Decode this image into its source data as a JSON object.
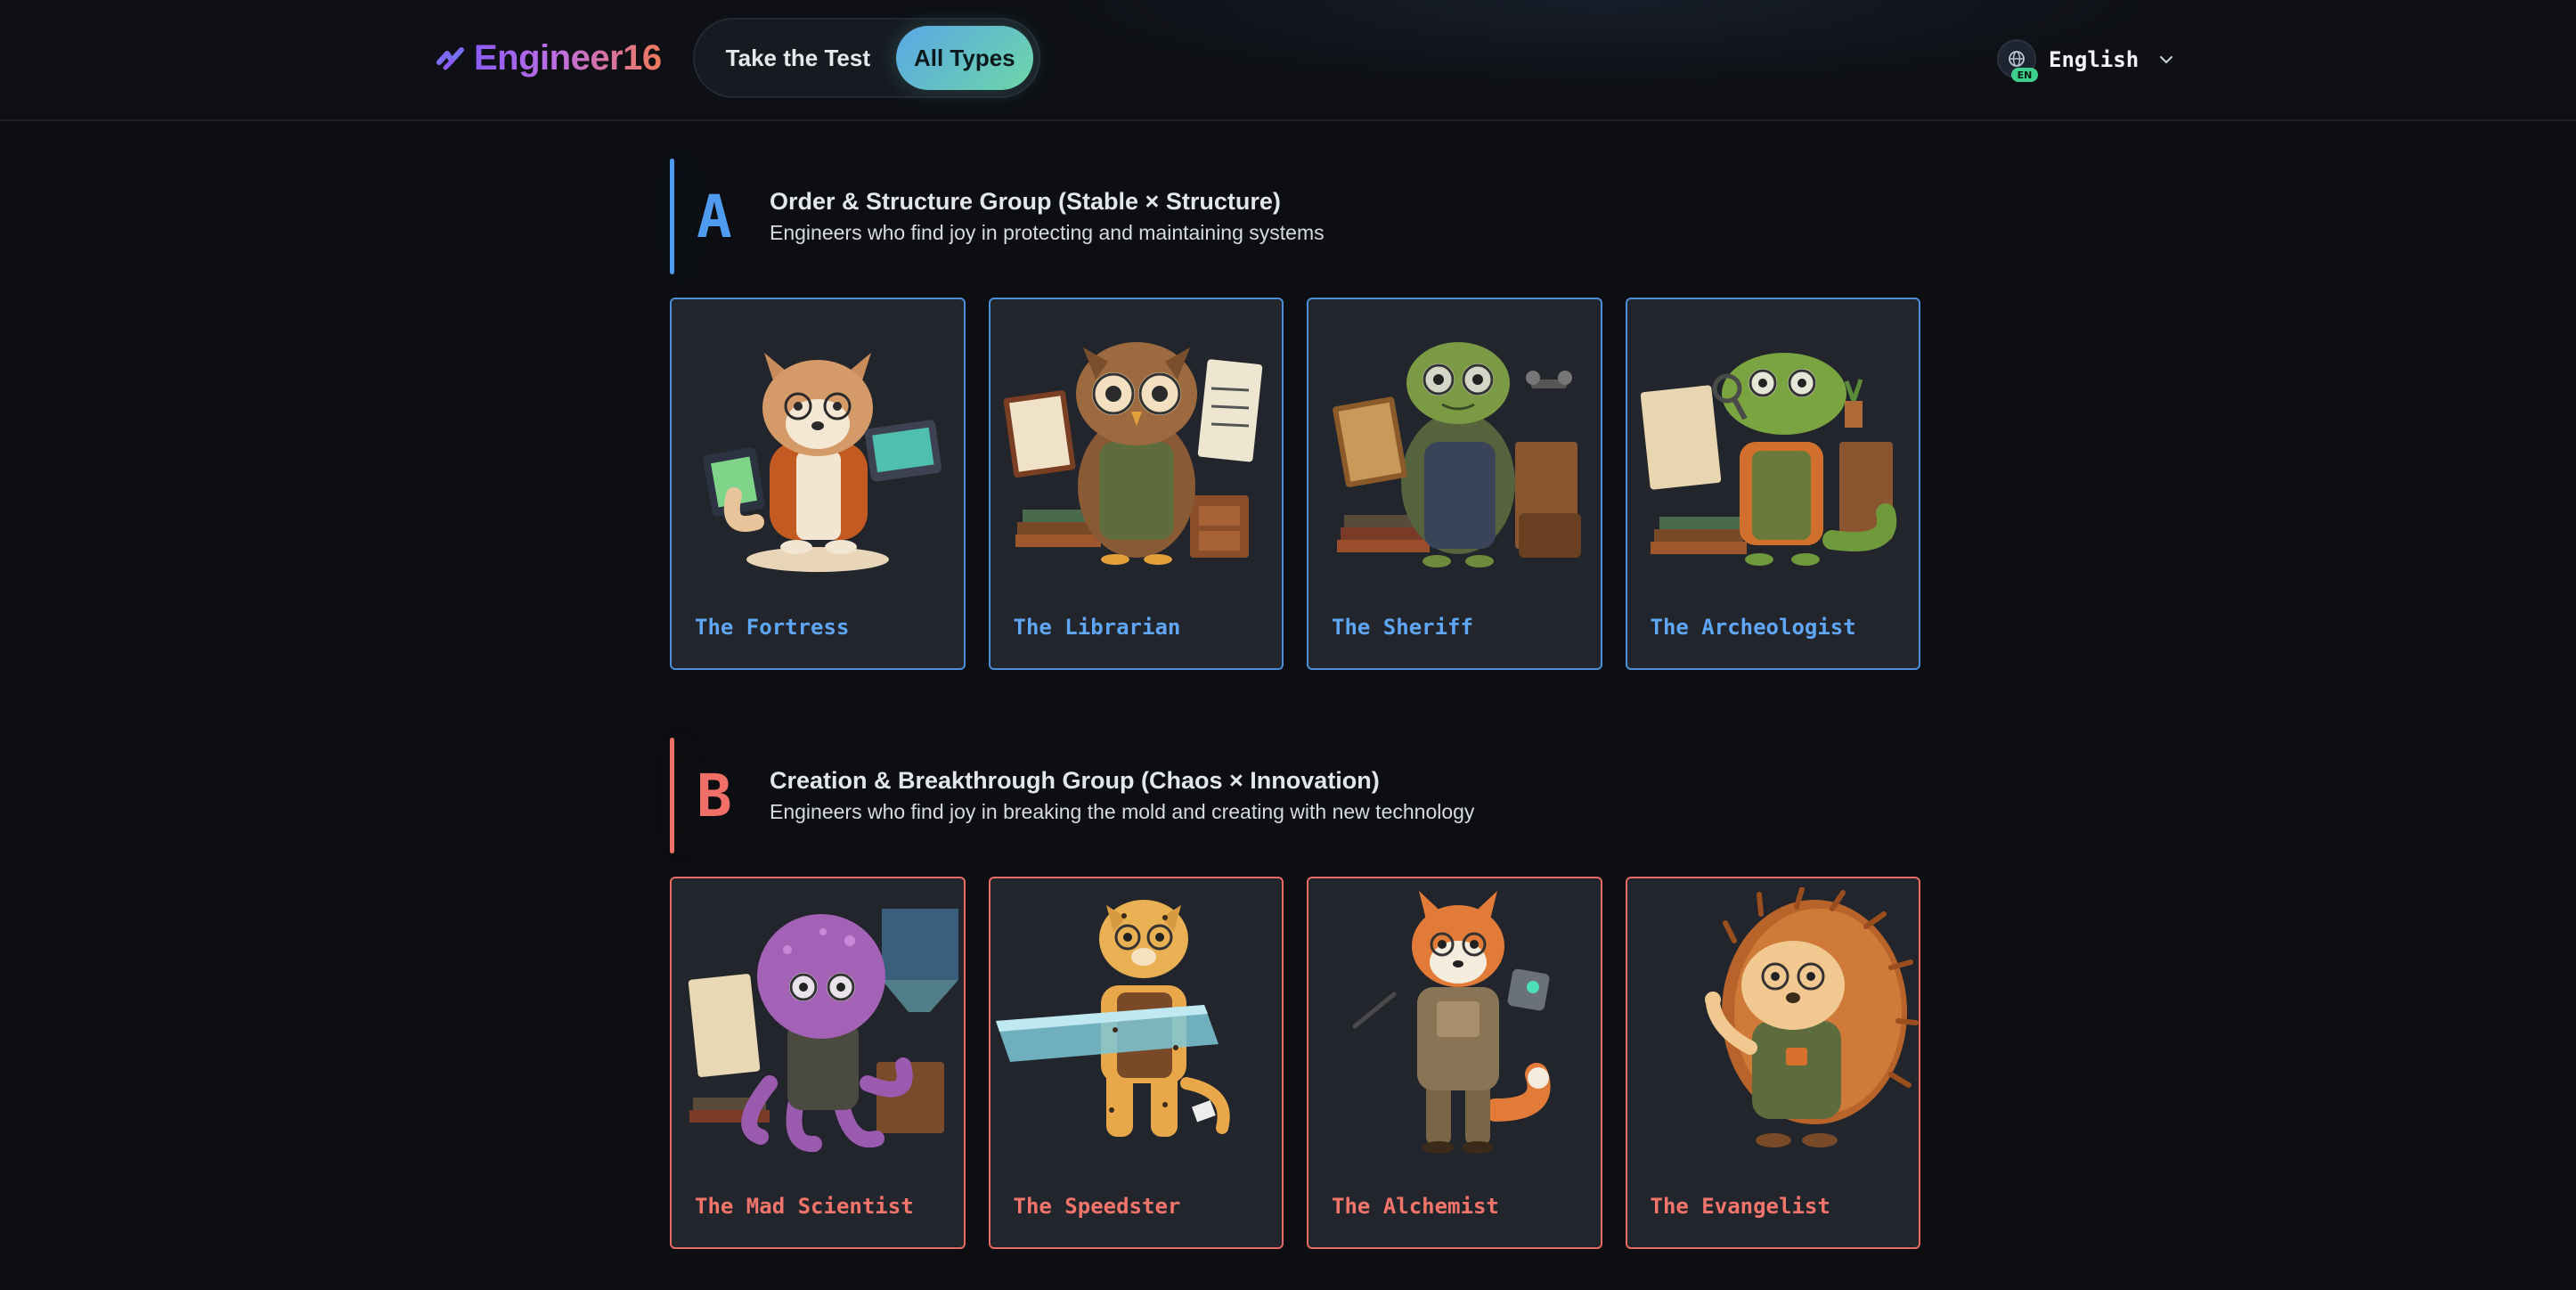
{
  "header": {
    "logo_text": "Engineer16",
    "nav": {
      "take_test": "Take the Test",
      "all_types": "All Types"
    },
    "language": {
      "label": "English",
      "badge": "EN"
    }
  },
  "groups": [
    {
      "letter": "A",
      "title": "Order & Structure Group (Stable × Structure)",
      "description": "Engineers who find joy in protecting and maintaining systems",
      "accent": "#4f9bf0",
      "types": [
        {
          "name": "The Fortress",
          "icon": "wolf-engineer-icon"
        },
        {
          "name": "The Librarian",
          "icon": "owl-engineer-icon"
        },
        {
          "name": "The Sheriff",
          "icon": "turtle-engineer-icon"
        },
        {
          "name": "The Archeologist",
          "icon": "lizard-engineer-icon"
        }
      ]
    },
    {
      "letter": "B",
      "title": "Creation & Breakthrough Group (Chaos × Innovation)",
      "description": "Engineers who find joy in breaking the mold and creating with new technology",
      "accent": "#f07068",
      "types": [
        {
          "name": "The Mad Scientist",
          "icon": "octopus-engineer-icon"
        },
        {
          "name": "The Speedster",
          "icon": "cheetah-engineer-icon"
        },
        {
          "name": "The Alchemist",
          "icon": "fox-engineer-icon"
        },
        {
          "name": "The Evangelist",
          "icon": "hedgehog-engineer-icon"
        }
      ]
    }
  ]
}
